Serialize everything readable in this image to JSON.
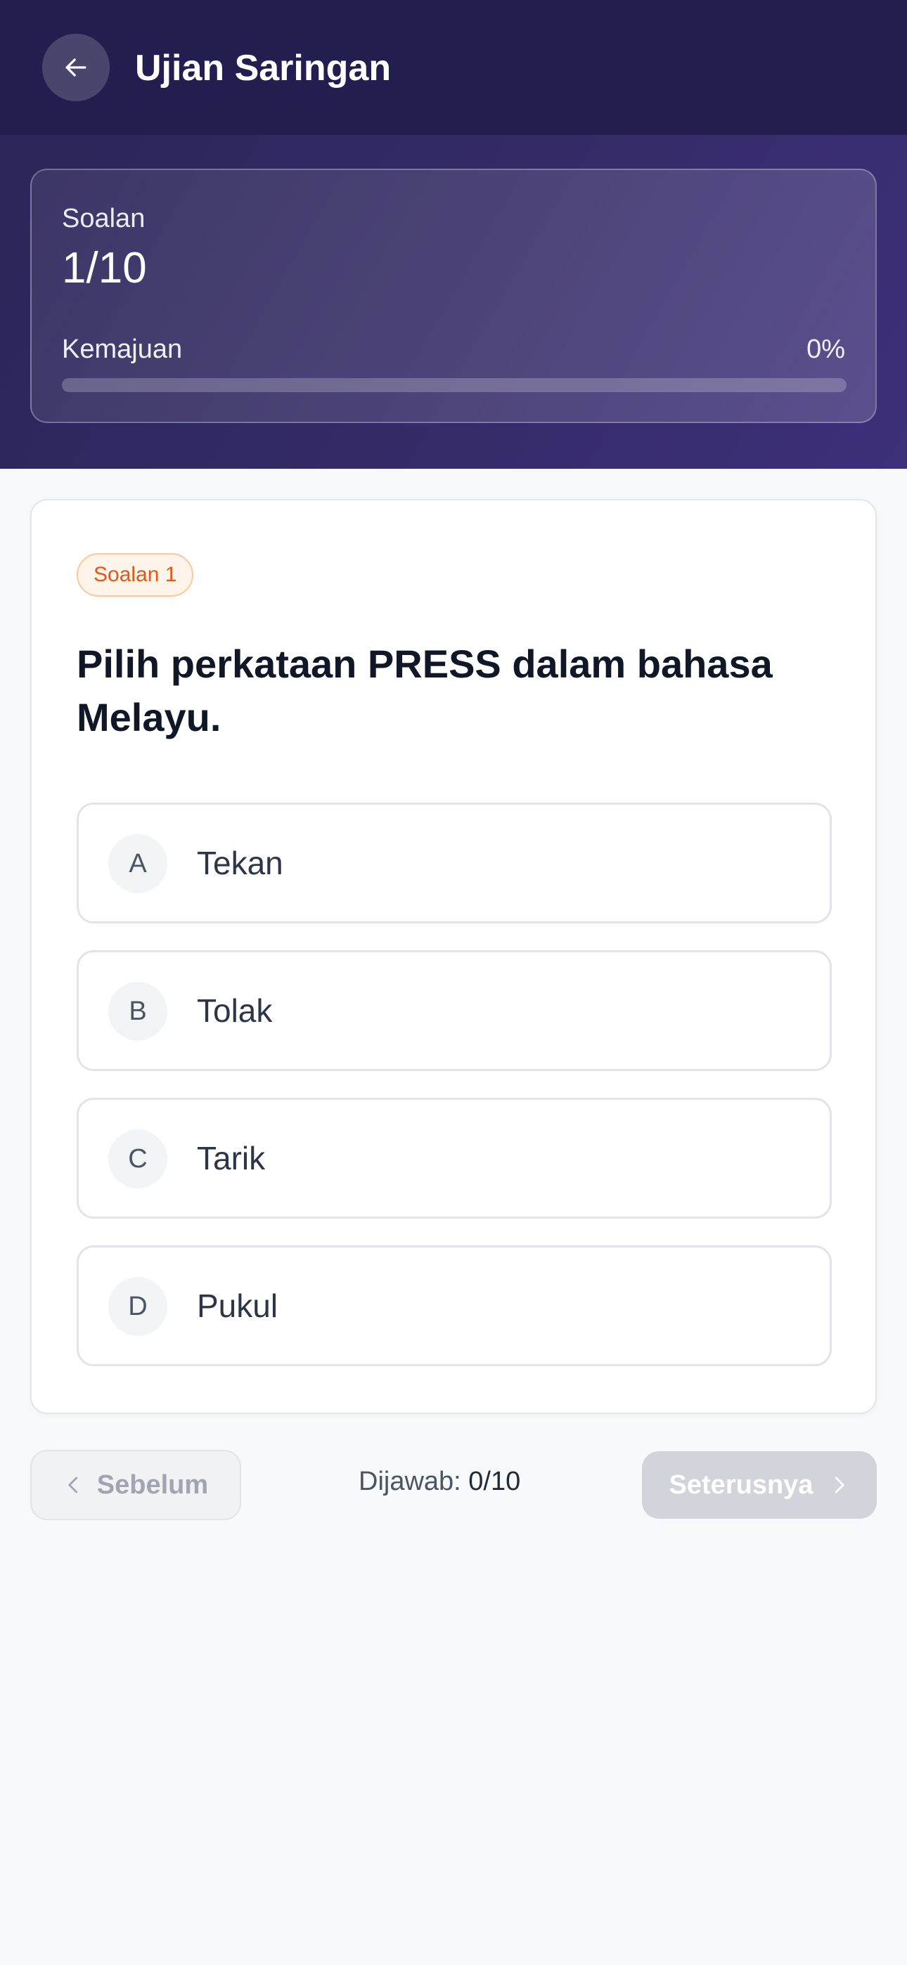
{
  "header": {
    "title": "Ujian Saringan",
    "back_icon": "arrow-left-icon"
  },
  "progress": {
    "question_label": "Soalan",
    "question_count": "1/10",
    "progress_label": "Kemajuan",
    "progress_percent_text": "0%",
    "progress_value": 0
  },
  "question": {
    "badge": "Soalan 1",
    "text": "Pilih perkataan PRESS dalam bahasa Melayu.",
    "options": [
      {
        "letter": "A",
        "text": "Tekan"
      },
      {
        "letter": "B",
        "text": "Tolak"
      },
      {
        "letter": "C",
        "text": "Tarik"
      },
      {
        "letter": "D",
        "text": "Pukul"
      }
    ]
  },
  "nav": {
    "prev_label": "Sebelum",
    "answered_label": "Dijawab:",
    "answered_count": "0/10",
    "next_label": "Seterusnya",
    "prev_icon": "chevron-left-icon",
    "next_icon": "chevron-right-icon"
  },
  "colors": {
    "header_bg": "#221e4f",
    "badge_text": "#e2571a",
    "badge_bg": "#fff4ea",
    "next_disabled_bg": "#d1d4db"
  }
}
